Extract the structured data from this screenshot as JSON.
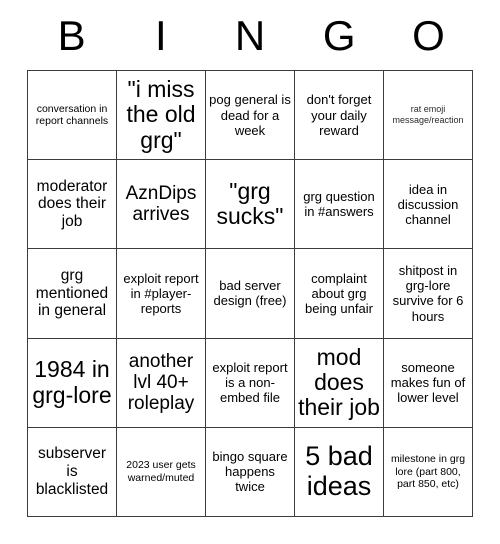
{
  "header": {
    "letters": [
      "B",
      "I",
      "N",
      "G",
      "O"
    ]
  },
  "grid": {
    "rows": 5,
    "columns": 5,
    "border_color": "#3c3c3c",
    "text_color": "#000000",
    "background_color": "#ffffff",
    "cells": [
      {
        "text": "conversation in report channels",
        "size": "s"
      },
      {
        "text": "\"i miss the old grg\"",
        "size": "xxl"
      },
      {
        "text": "pog general is dead for a week",
        "size": "m"
      },
      {
        "text": "don't forget your daily reward",
        "size": "m"
      },
      {
        "text": "rat emoji message/reaction",
        "size": "xs"
      },
      {
        "text": "moderator does their job",
        "size": "l"
      },
      {
        "text": "AznDips arrives",
        "size": "xl"
      },
      {
        "text": "\"grg sucks\"",
        "size": "xxl"
      },
      {
        "text": "grg question in #answers",
        "size": "m"
      },
      {
        "text": "idea in discussion channel",
        "size": "m"
      },
      {
        "text": "grg mentioned in general",
        "size": "l"
      },
      {
        "text": "exploit report in #player-reports",
        "size": "m"
      },
      {
        "text": "bad server design (free)",
        "size": "m"
      },
      {
        "text": "complaint about grg being unfair",
        "size": "m"
      },
      {
        "text": "shitpost in grg-lore survive for 6 hours",
        "size": "m"
      },
      {
        "text": "1984 in grg-lore",
        "size": "xxl"
      },
      {
        "text": "another lvl 40+ roleplay",
        "size": "xl"
      },
      {
        "text": "exploit report is a non-embed file",
        "size": "m"
      },
      {
        "text": "mod does their job",
        "size": "xxl"
      },
      {
        "text": "someone makes fun of lower level",
        "size": "m"
      },
      {
        "text": "subserver is blacklisted",
        "size": "l"
      },
      {
        "text": "2023 user gets warned/muted",
        "size": "s"
      },
      {
        "text": "bingo square happens twice",
        "size": "m"
      },
      {
        "text": "5 bad ideas",
        "size": "xxxl"
      },
      {
        "text": "milestone in grg lore (part 800, part 850, etc)",
        "size": "s"
      }
    ]
  }
}
